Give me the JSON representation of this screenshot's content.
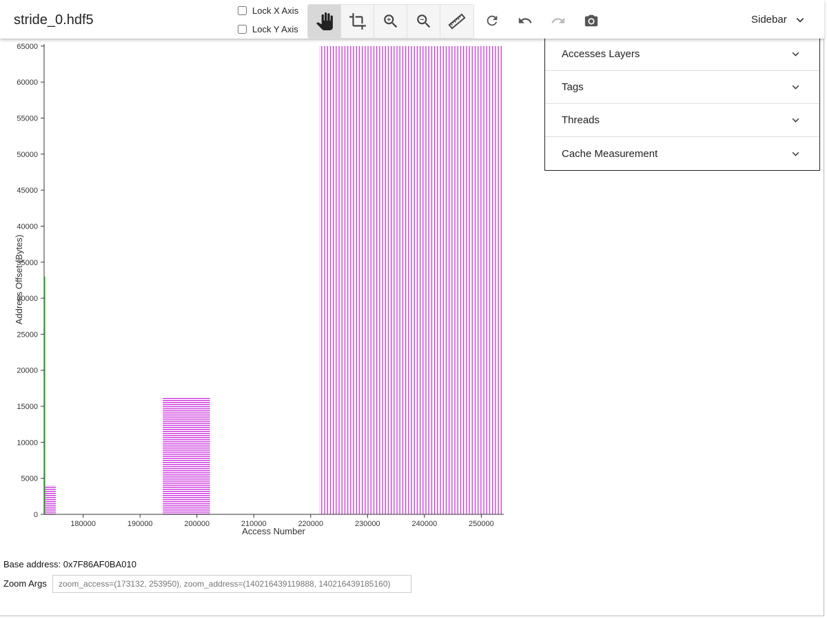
{
  "window": {
    "file_name": "stride_0.hdf5"
  },
  "toolbar": {
    "lock_x_label": "Lock X Axis",
    "lock_y_label": "Lock Y Axis",
    "tools": [
      "pan-icon",
      "crop-icon",
      "zoom-in-icon",
      "zoom-out-icon",
      "ruler-icon"
    ],
    "actions": [
      "refresh-icon",
      "undo-icon",
      "redo-icon",
      "camera-icon"
    ],
    "sidebar_label": "Sidebar"
  },
  "sidebar": {
    "items": [
      {
        "label": "Accesses Layers"
      },
      {
        "label": "Tags"
      },
      {
        "label": "Threads"
      },
      {
        "label": "Cache Measurement"
      }
    ]
  },
  "footer": {
    "base_address": "Base address: 0x7F86AF0BA010",
    "zoom_label": "Zoom Args",
    "zoom_value": "zoom_access=(173132, 253950), zoom_address=(140216439119888, 140216439185160)"
  },
  "colors": {
    "accent": "#cc33dd",
    "marker": "#33dd33"
  },
  "chart_data": {
    "type": "scatter",
    "xlabel": "Access Number",
    "ylabel": "Address Offset (Bytes)",
    "xlim": [
      173132,
      253950
    ],
    "ylim": [
      0,
      65272
    ],
    "x_ticks": [
      180000,
      190000,
      200000,
      210000,
      220000,
      230000,
      240000,
      250000
    ],
    "y_ticks": [
      0,
      5000,
      10000,
      15000,
      20000,
      25000,
      30000,
      35000,
      40000,
      45000,
      50000,
      55000,
      60000,
      65000
    ],
    "blocks": [
      {
        "x_start": 173300,
        "x_end": 175200,
        "y_start": 0,
        "y_end": 4000
      },
      {
        "x_start": 194000,
        "x_end": 202300,
        "y_start": 0,
        "y_end": 16300
      },
      {
        "x_start": 221500,
        "x_end": 253800,
        "y_start": 0,
        "y_end": 65000
      }
    ],
    "marker_line": {
      "x": 173132,
      "y_start": 0,
      "y_end": 33000
    }
  }
}
